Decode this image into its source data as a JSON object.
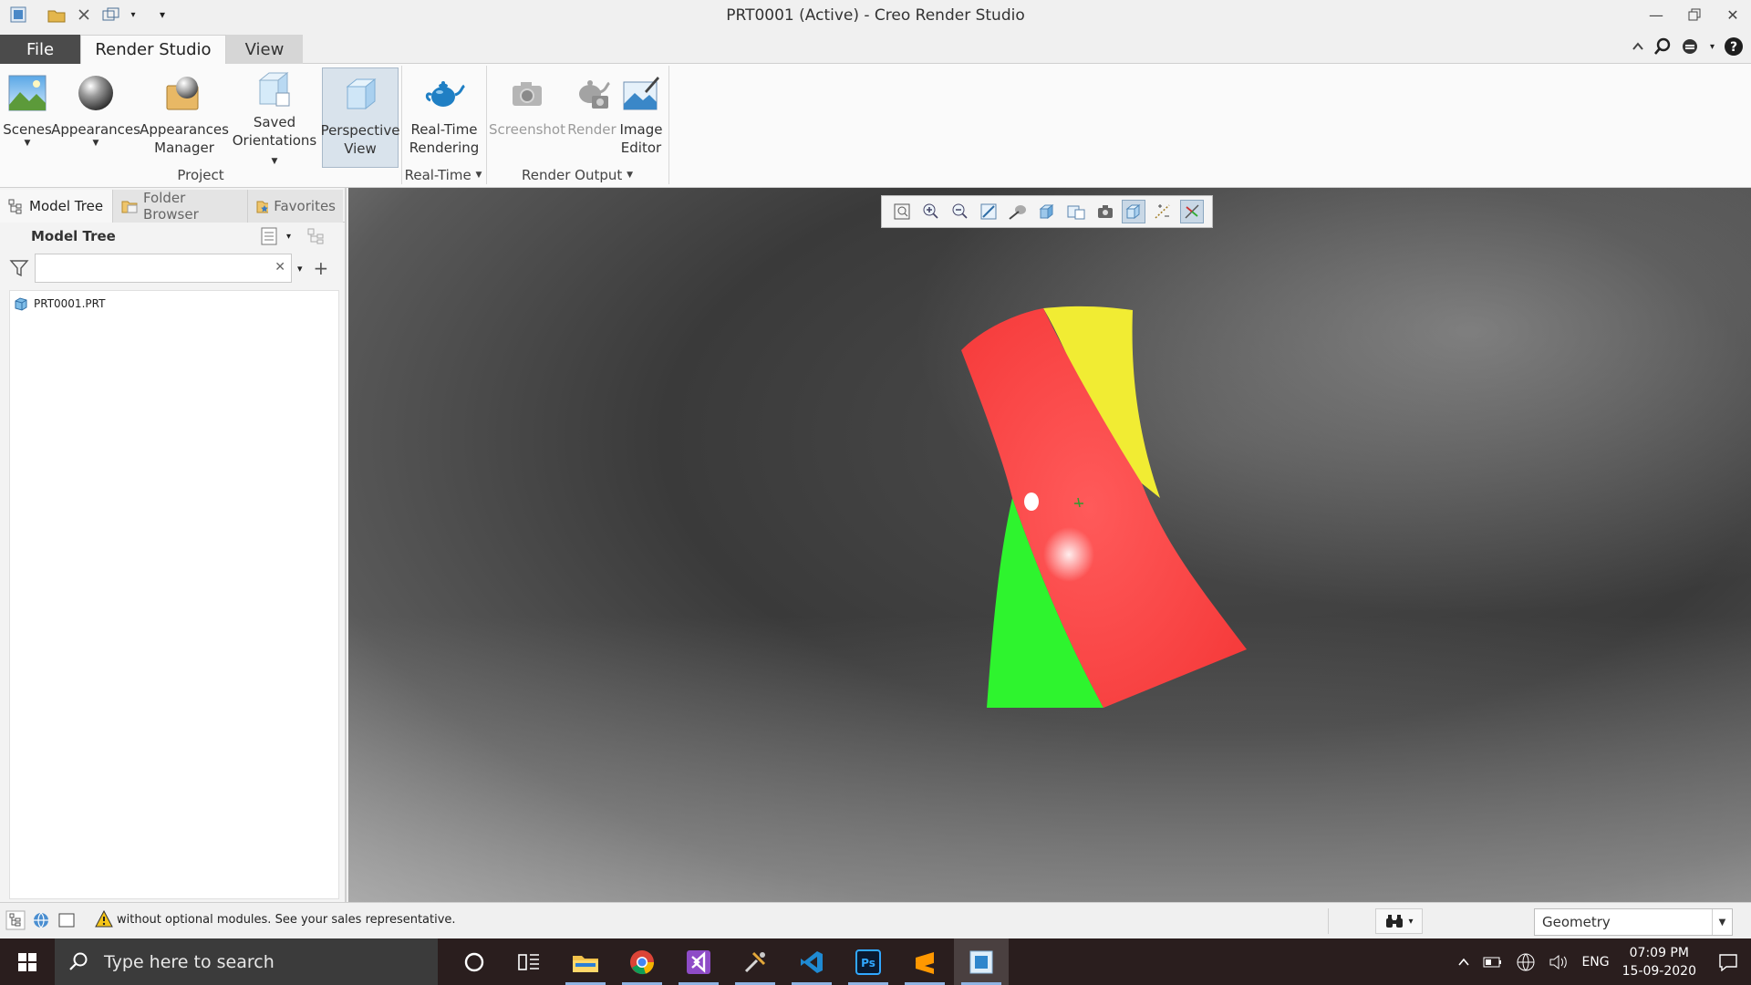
{
  "window": {
    "title": "PRT0001 (Active) - Creo Render Studio"
  },
  "quick_access": {
    "icons": [
      "app-icon",
      "open-folder-icon",
      "close-window-icon",
      "switch-windows-icon",
      "customize-qat-icon"
    ]
  },
  "tabs": {
    "file": "File",
    "render_studio": "Render Studio",
    "view": "View"
  },
  "ribbon": {
    "scenes": "Scenes",
    "appearances": "Appearances",
    "appearances_manager_1": "Appearances",
    "appearances_manager_2": "Manager",
    "saved_orientations_1": "Saved",
    "saved_orientations_2": "Orientations",
    "perspective_view_1": "Perspective",
    "perspective_view_2": "View",
    "realtime_rendering_1": "Real-Time",
    "realtime_rendering_2": "Rendering",
    "screenshot": "Screenshot",
    "render": "Render",
    "image_editor_1": "Image",
    "image_editor_2": "Editor",
    "groups": {
      "project": "Project",
      "real_time": "Real-Time",
      "render_output": "Render Output"
    }
  },
  "left_pane": {
    "tabs": {
      "model_tree": "Model Tree",
      "folder_browser": "Folder Browser",
      "favorites": "Favorites"
    },
    "heading": "Model Tree",
    "search_placeholder": "",
    "tree_items": [
      "PRT0001.PRT"
    ]
  },
  "viewport_toolbar": {
    "icons": [
      "refit-icon",
      "zoom-in-icon",
      "zoom-out-icon",
      "repaint-icon",
      "display-style-icon",
      "saved-orientations-icon",
      "view-manager-icon",
      "screenshot-icon",
      "perspective-icon",
      "datum-display-icon",
      "spin-center-icon"
    ]
  },
  "model": {
    "colors": {
      "red": "#fa3e3e",
      "yellow": "#f3ee33",
      "green": "#2ef42e"
    }
  },
  "statusbar": {
    "message": "without optional modules.  See your sales representative.",
    "selection_filter": "Geometry"
  },
  "taskbar": {
    "search_placeholder": "Type here to search",
    "apps": [
      "cortana-icon",
      "task-view-icon",
      "file-explorer-icon",
      "chrome-icon",
      "visual-studio-icon",
      "tools-icon",
      "vscode-icon",
      "photoshop-icon",
      "sublime-icon",
      "creo-icon"
    ],
    "tray": {
      "language": "ENG",
      "time": "07:09 PM",
      "date": "15-09-2020"
    }
  },
  "accent_colors": {
    "file_tab": "#4b4b4b",
    "taskbar": "#2a1e1e"
  }
}
